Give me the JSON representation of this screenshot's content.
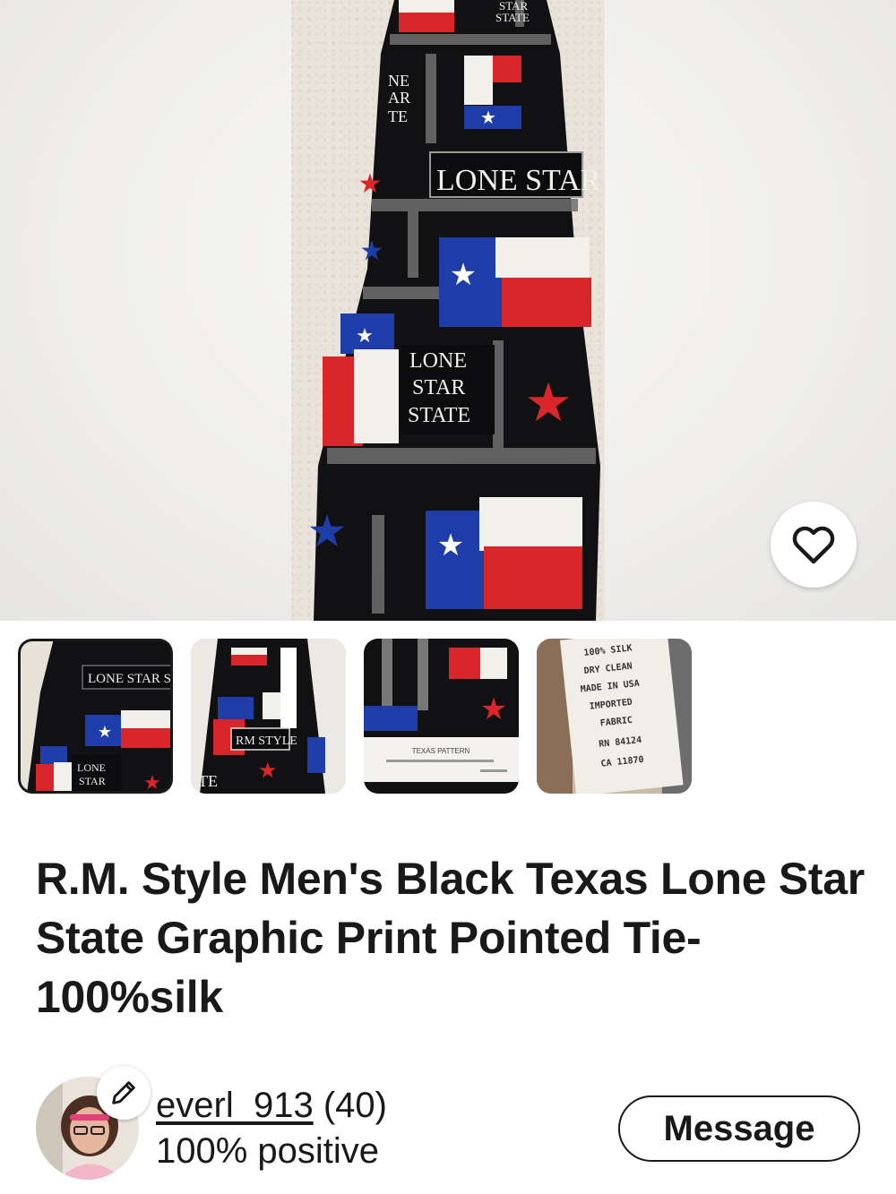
{
  "hero": {
    "tie_texts": [
      "STAR",
      "STATE",
      "NE",
      "AR",
      "TE",
      "LONE STAR ST",
      "LONE",
      "STAR",
      "STATE"
    ],
    "favorite_icon": "heart-outline-icon"
  },
  "thumbnails": [
    {
      "selected": true,
      "texts": [
        "LONE STAR ST",
        "LONE",
        "STAR"
      ]
    },
    {
      "selected": false,
      "texts": [
        "RM STYLE",
        "TE"
      ]
    },
    {
      "selected": false,
      "texts": [
        "TEXAS PATTERN"
      ]
    },
    {
      "selected": false,
      "texts": [
        "100% SILK",
        "DRY CLEAN",
        "MADE IN USA",
        "IMPORTED",
        "FABRIC",
        "RN 84124",
        "CA 11870"
      ]
    }
  ],
  "listing": {
    "title": "R.M. Style Men's Black Texas Lone Star State Graphic Print Pointed Tie-100%silk"
  },
  "seller": {
    "username": "everl_913",
    "feedback_count": "(40)",
    "positive": "100% positive",
    "edit_icon": "pencil-icon",
    "message_label": "Message"
  },
  "colors": {
    "text": "#191919",
    "flag_red": "#d8262a",
    "flag_blue": "#1f3da8",
    "tie_black": "#111114"
  }
}
